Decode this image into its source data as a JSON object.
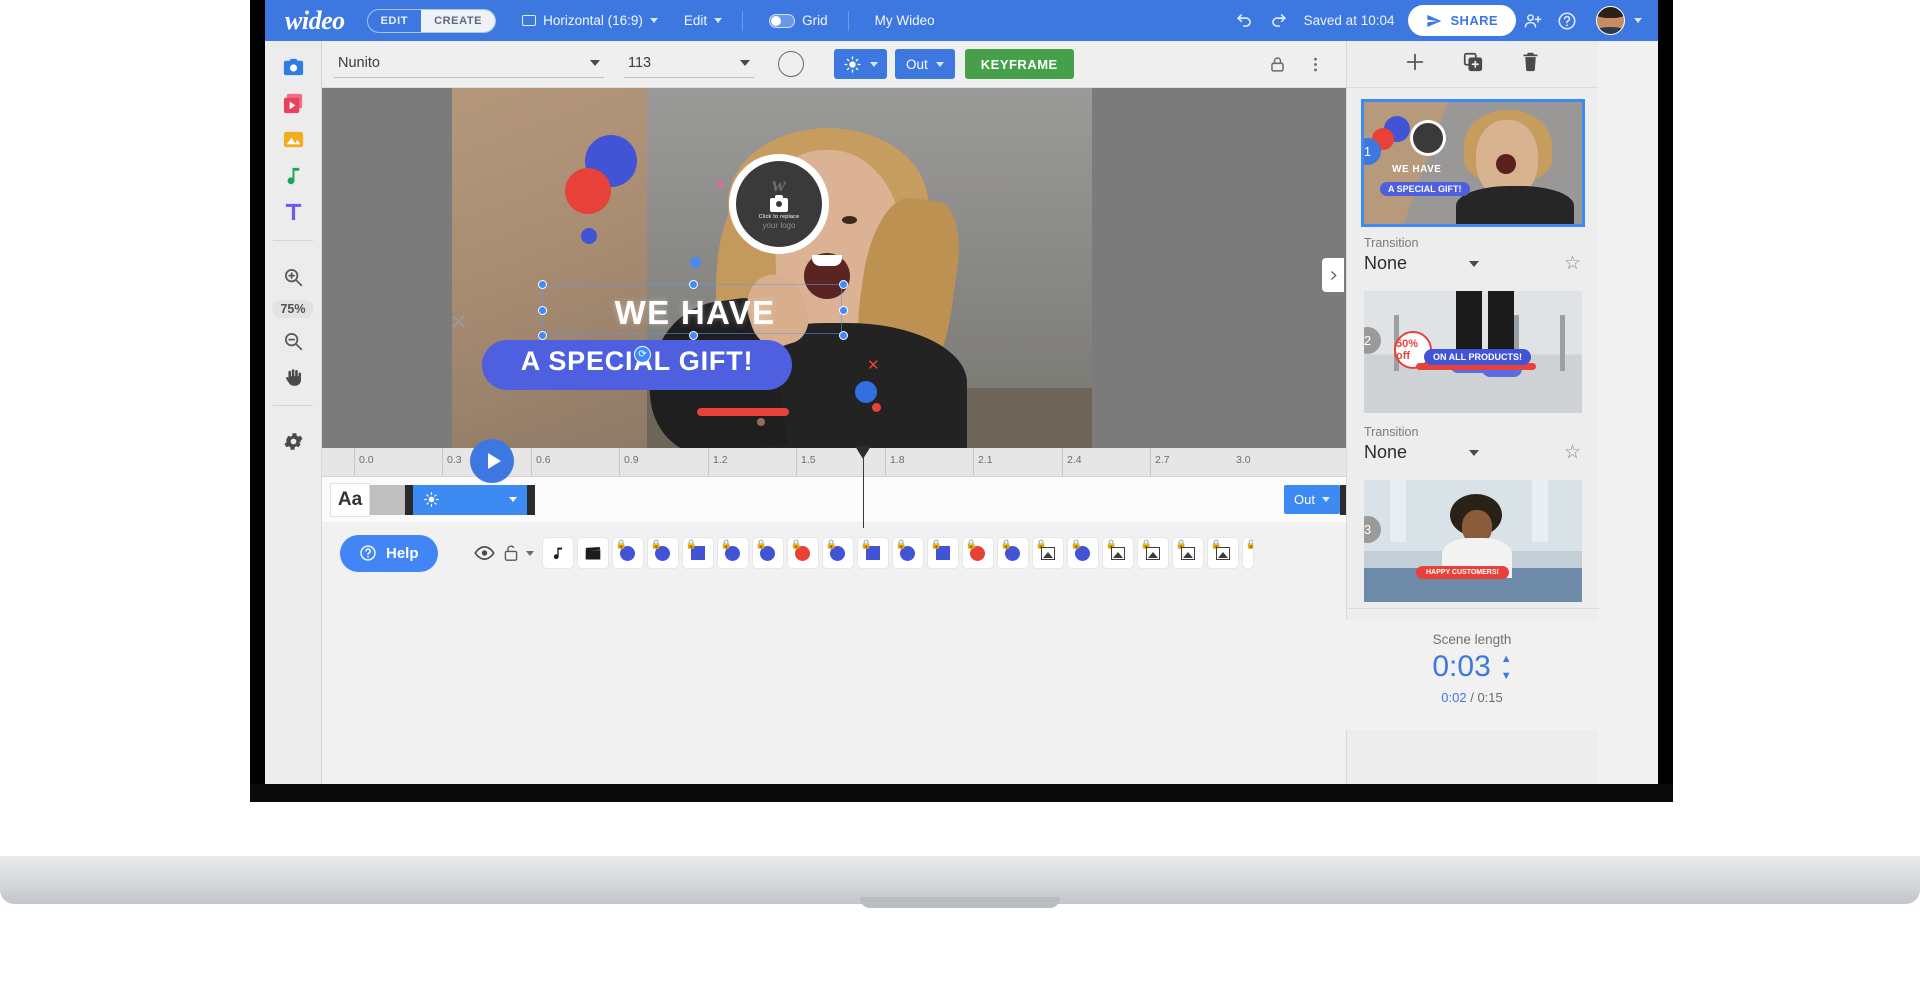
{
  "app": {
    "name": "Wideo Editor",
    "logo_text": "wideo"
  },
  "topbar": {
    "mode_edit": "EDIT",
    "mode_create": "CREATE",
    "format": "Horizontal (16:9)",
    "edit_menu": "Edit",
    "grid_label": "Grid",
    "project_title": "My Wideo",
    "undo_icon": "undo-icon",
    "redo_icon": "redo-icon",
    "saved_status": "Saved at 10:04",
    "share_label": "SHARE",
    "share_icon": "send-icon",
    "add_user_icon": "add-user-icon",
    "help_icon": "question-mark-icon",
    "avatar_icon": "user-avatar",
    "avatar_caret": "chevron-down-icon"
  },
  "left_rail": {
    "tools": [
      {
        "name": "image-tool",
        "icon": "camera-icon",
        "color": "#2f7de0"
      },
      {
        "name": "video-tool",
        "icon": "video-icon",
        "color": "#e8425a"
      },
      {
        "name": "gallery-tool",
        "icon": "gallery-icon",
        "color": "#f0ad20"
      },
      {
        "name": "audio-tool",
        "icon": "music-note-icon",
        "color": "#18a558"
      },
      {
        "name": "text-tool",
        "icon": "text-t-icon",
        "color": "#6b5ce7"
      }
    ],
    "zoom_in_icon": "zoom-in-icon",
    "zoom_level": "75%",
    "zoom_out_icon": "zoom-out-icon",
    "hand_icon": "hand-pan-icon",
    "settings_icon": "gear-icon"
  },
  "toolbar": {
    "font_family": "Nunito",
    "font_size": "113",
    "color_swatch_icon": "color-circle-icon",
    "animation_icon": "animation-burst-icon",
    "direction": "Out",
    "keyframe_label": "KEYFRAME",
    "lock_icon": "lock-icon",
    "more_icon": "more-vertical-icon"
  },
  "canvas": {
    "headline": "WE HAVE",
    "subhead": "A SPECIAL GIFT!",
    "logo_placeholder": {
      "brand": "w",
      "caption": "Click to replace",
      "subtitle": "your logo",
      "icon": "camera-icon"
    },
    "next_arrow_icon": "chevron-right-icon",
    "play_icon": "play-icon"
  },
  "timeline": {
    "ticks": [
      "0.0",
      "0.3",
      "0.6",
      "0.9",
      "1.2",
      "1.5",
      "1.8",
      "2.1",
      "2.4",
      "2.7",
      "3.0"
    ],
    "playhead_time": "1.75",
    "track_type_label": "Aa",
    "clip_direction": "Out",
    "clip_icon": "animation-burst-icon",
    "clip_caret": "chevron-down-icon"
  },
  "bottombar": {
    "help_label": "Help",
    "help_icon": "question-circle-icon",
    "eye_icon": "eye-icon",
    "unlock_icon": "unlock-icon",
    "unlock_caret": "chevron-down-icon",
    "layers": [
      {
        "icon": "music-note-icon",
        "locked": false
      },
      {
        "icon": "clapperboard-icon",
        "locked": false
      },
      {
        "icon": "blue-circle",
        "locked": true
      },
      {
        "icon": "blue-circle",
        "locked": true
      },
      {
        "icon": "blue-square",
        "locked": true
      },
      {
        "icon": "blue-circle",
        "locked": true
      },
      {
        "icon": "blue-circle",
        "locked": true
      },
      {
        "icon": "red-circle",
        "locked": true
      },
      {
        "icon": "blue-circle",
        "locked": true
      },
      {
        "icon": "blue-square",
        "locked": true
      },
      {
        "icon": "blue-circle",
        "locked": true
      },
      {
        "icon": "blue-square",
        "locked": true
      },
      {
        "icon": "red-circle",
        "locked": true
      },
      {
        "icon": "blue-circle",
        "locked": true
      },
      {
        "icon": "image-icon",
        "locked": true
      },
      {
        "icon": "blue-circle",
        "locked": true
      },
      {
        "icon": "image-icon",
        "locked": true
      },
      {
        "icon": "image-icon",
        "locked": true
      },
      {
        "icon": "image-icon",
        "locked": true
      },
      {
        "icon": "image-icon",
        "locked": true
      },
      {
        "icon": "image-icon",
        "locked": true
      }
    ]
  },
  "scenes_panel": {
    "add_scene_icon": "plus-icon",
    "duplicate_scene_icon": "duplicate-icon",
    "delete_scene_icon": "trash-icon",
    "scenes": [
      {
        "number": "1",
        "selected": true,
        "transition_label": "Transition",
        "transition_value": "None",
        "caption_top": "WE HAVE",
        "caption_bottom": "A SPECIAL GIFT!",
        "favorite_icon": "star-outline-icon"
      },
      {
        "number": "2",
        "selected": false,
        "transition_label": "Transition",
        "transition_value": "None",
        "badge_text": "50% off",
        "caption_bottom": "ON ALL PRODUCTS!",
        "favorite_icon": "star-outline-icon"
      },
      {
        "number": "3",
        "selected": false,
        "caption_bottom": "HAPPY CUSTOMERS!"
      }
    ],
    "scene_length_label": "Scene length",
    "scene_length_value": "0:03",
    "spinner_up_icon": "chevron-up-icon",
    "spinner_down_icon": "chevron-down-icon",
    "current_time": "0:02",
    "separator": "/",
    "total_time": "0:15"
  },
  "colors": {
    "brand_blue": "#3d78e0",
    "accent_green": "#46a04a",
    "clip_blue": "#3d8bf2",
    "red": "#e8413a",
    "purple": "#4e5fe0"
  }
}
